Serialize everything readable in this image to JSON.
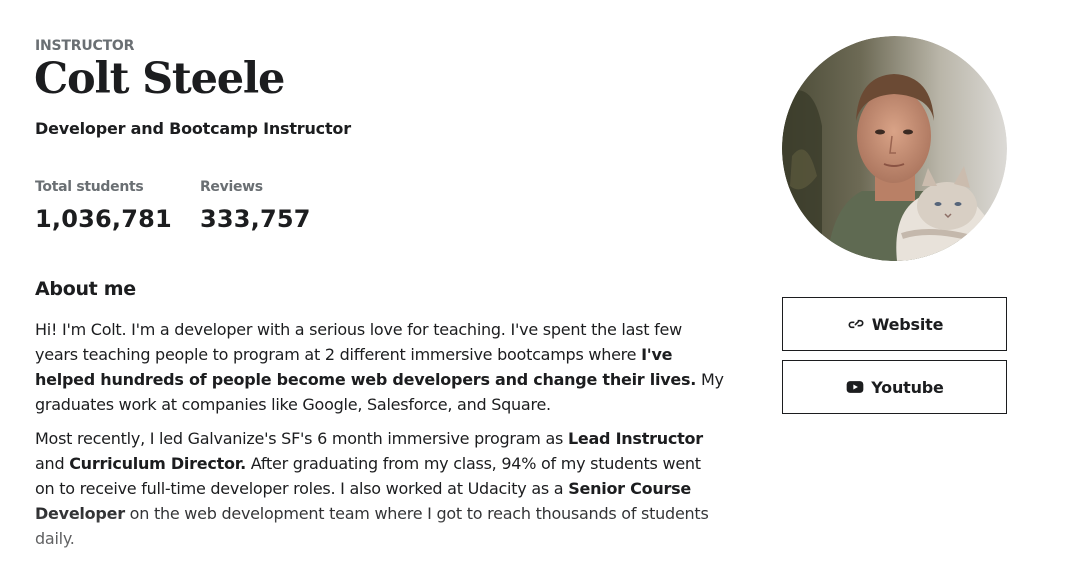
{
  "instructor": {
    "eyebrow": "INSTRUCTOR",
    "name": "Colt Steele",
    "headline": "Developer and Bootcamp Instructor"
  },
  "stats": [
    {
      "label": "Total students",
      "value": "1,036,781"
    },
    {
      "label": "Reviews",
      "value": "333,757"
    }
  ],
  "about": {
    "title": "About me",
    "p1": [
      {
        "text": "Hi! I'm Colt. I'm a developer with a serious love for teaching. I've spent the last few years teaching people to program at 2 different immersive bootcamps where ",
        "bold": false
      },
      {
        "text": "I've helped hundreds of people become web developers and change their lives.",
        "bold": true
      },
      {
        "text": " My graduates work at companies like Google, Salesforce, and Square.",
        "bold": false
      }
    ],
    "p2": [
      {
        "text": "Most recently, I led Galvanize's SF's 6 month immersive program as ",
        "bold": false
      },
      {
        "text": "Lead Instructor",
        "bold": true
      },
      {
        "text": " and ",
        "bold": false
      },
      {
        "text": "Curriculum Director.",
        "bold": true
      },
      {
        "text": " After graduating from my class, 94% of my students went on to receive full-time developer roles. I also worked at Udacity as a ",
        "bold": false
      },
      {
        "text": "Senior Course Developer",
        "bold": true
      },
      {
        "text": " on the web development team where I got to reach thousands of students daily.",
        "bold": false
      }
    ]
  },
  "links": {
    "website": {
      "label": "Website",
      "icon": "link-icon"
    },
    "youtube": {
      "label": "Youtube",
      "icon": "youtube-icon"
    }
  },
  "avatar": {
    "icon": "instructor-photo"
  },
  "colors": {
    "text": "#1c1d1f",
    "muted": "#6a6f73",
    "border": "#1c1d1f"
  }
}
